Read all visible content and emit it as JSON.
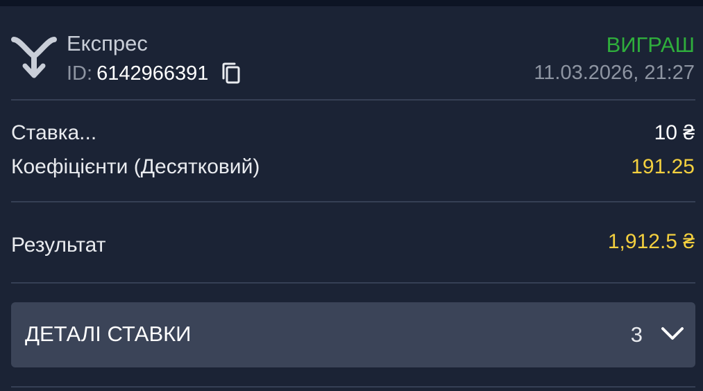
{
  "header": {
    "bet_type": "Експрес",
    "id_prefix": "ID:",
    "id_value": "6142966391",
    "status": "ВИГРАШ",
    "date": "11.03.2026, 21:27",
    "express_icon": "express-split-arrow-icon",
    "copy_icon": "copy-icon"
  },
  "summary": {
    "stake_label": "Ставка...",
    "stake_value": "10 ₴",
    "odds_label": "Коефіцієнти (Десятковий)",
    "odds_value": "191.25",
    "result_label": "Результат",
    "result_value": "1,912.5 ₴"
  },
  "details": {
    "label": "ДЕТАЛІ СТАВКИ",
    "count": "3",
    "chevron_icon": "chevron-down-icon"
  },
  "colors": {
    "background": "#1b2335",
    "win_green": "#2fae3c",
    "accent_yellow": "#f4d03f",
    "details_bar": "#3b4458"
  }
}
